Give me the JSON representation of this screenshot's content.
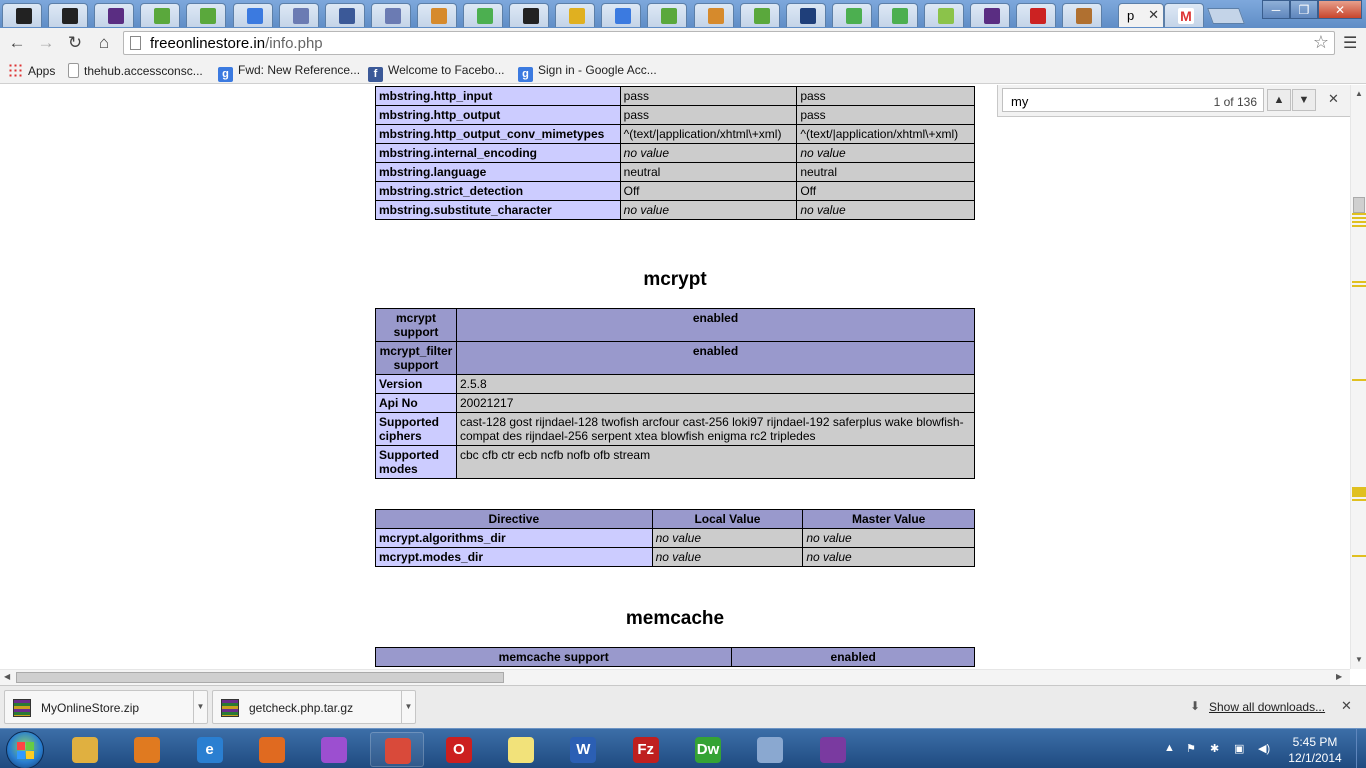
{
  "browser": {
    "active_tab_title": "p",
    "url_host": "freeonlinestore.in",
    "url_path": "/info.php",
    "tabs": [
      {
        "icon": "bookmark-black-icon",
        "color": "#222222"
      },
      {
        "icon": "bookmark-black-icon",
        "color": "#222222"
      },
      {
        "icon": "mail-purple-icon",
        "color": "#5a2d82"
      },
      {
        "icon": "evernote-green-icon",
        "color": "#5aa83c"
      },
      {
        "icon": "evernote-green-icon",
        "color": "#5aa83c"
      },
      {
        "icon": "google-blue-icon",
        "color": "#3b7ae0"
      },
      {
        "icon": "php-icon",
        "color": "#6b7bb3"
      },
      {
        "icon": "facebook-icon",
        "color": "#3b5998"
      },
      {
        "icon": "php-icon",
        "color": "#6b7bb3"
      },
      {
        "icon": "stack-icon",
        "color": "#d68a2c"
      },
      {
        "icon": "w3-green-icon",
        "color": "#4caf50"
      },
      {
        "icon": "bookmark-black-icon",
        "color": "#222222"
      },
      {
        "icon": "sun-icon",
        "color": "#e0b020"
      },
      {
        "icon": "google-blue-icon",
        "color": "#3b7ae0"
      },
      {
        "icon": "evernote-green-icon",
        "color": "#5aa83c"
      },
      {
        "icon": "stack-icon",
        "color": "#d68a2c"
      },
      {
        "icon": "evernote-green-icon",
        "color": "#5aa83c"
      },
      {
        "icon": "puzzle-icon",
        "color": "#1f3f7a"
      },
      {
        "icon": "w3-green-icon",
        "color": "#4caf50"
      },
      {
        "icon": "w3-green-icon",
        "color": "#4caf50"
      },
      {
        "icon": "php-green-icon",
        "color": "#8bc34a"
      },
      {
        "icon": "mail-purple-icon",
        "color": "#5a2d82"
      },
      {
        "icon": "youtube-icon",
        "color": "#cc2222"
      },
      {
        "icon": "picture-icon",
        "color": "#b07030"
      }
    ]
  },
  "bookmarks": [
    {
      "label": "Apps",
      "icon": "apps-grid-icon"
    },
    {
      "label": "thehub.accessconsc...",
      "icon": "page-icon",
      "color": "#ffffff"
    },
    {
      "label": "Fwd: New Reference...",
      "icon": "google-icon",
      "color": "#3b7ae0",
      "glyph": "g"
    },
    {
      "label": "Welcome to Facebo...",
      "icon": "facebook-icon",
      "color": "#3b5998",
      "glyph": "f"
    },
    {
      "label": "Sign in - Google Acc...",
      "icon": "google-icon",
      "color": "#3b7ae0",
      "glyph": "g"
    }
  ],
  "find": {
    "query": "my",
    "count": "1 of 136",
    "prev": "▲",
    "next": "▼",
    "close": "✕"
  },
  "mbstring_rows": [
    {
      "name": "mbstring.http_input",
      "local": "pass",
      "master": "pass",
      "nv": false
    },
    {
      "name": "mbstring.http_output",
      "local": "pass",
      "master": "pass",
      "nv": false
    },
    {
      "name": "mbstring.http_output_conv_mimetypes",
      "local": "^(text/|application/xhtml\\+xml)",
      "master": "^(text/|application/xhtml\\+xml)",
      "nv": false
    },
    {
      "name": "mbstring.internal_encoding",
      "local": "no value",
      "master": "no value",
      "nv": true
    },
    {
      "name": "mbstring.language",
      "local": "neutral",
      "master": "neutral",
      "nv": false
    },
    {
      "name": "mbstring.strict_detection",
      "local": "Off",
      "master": "Off",
      "nv": false
    },
    {
      "name": "mbstring.substitute_character",
      "local": "no value",
      "master": "no value",
      "nv": true
    }
  ],
  "mcrypt": {
    "heading": "mcrypt",
    "info_rows": [
      {
        "name": "mcrypt support",
        "value": "enabled",
        "header": true
      },
      {
        "name": "mcrypt_filter support",
        "value": "enabled",
        "header": true
      },
      {
        "name": "Version",
        "value": "2.5.8",
        "header": false
      },
      {
        "name": "Api No",
        "value": "20021217",
        "header": false
      },
      {
        "name": "Supported ciphers",
        "value": "cast-128 gost rijndael-128 twofish arcfour cast-256 loki97 rijndael-192 saferplus wake blowfish-compat des rijndael-256 serpent xtea blowfish enigma rc2 tripledes",
        "header": false
      },
      {
        "name": "Supported modes",
        "value": "cbc cfb ctr ecb ncfb nofb ofb stream",
        "header": false
      }
    ],
    "directive_headers": {
      "directive": "Directive",
      "local": "Local Value",
      "master": "Master Value"
    },
    "directive_rows": [
      {
        "name": "mcrypt.algorithms_dir",
        "local": "no value",
        "master": "no value"
      },
      {
        "name": "mcrypt.modes_dir",
        "local": "no value",
        "master": "no value"
      }
    ]
  },
  "memcache": {
    "heading": "memcache",
    "support_label": "memcache support",
    "support_value": "enabled"
  },
  "downloads": [
    {
      "name": "MyOnlineStore.zip"
    },
    {
      "name": "getcheck.php.tar.gz"
    }
  ],
  "show_all_downloads": "Show all downloads...",
  "taskbar": {
    "apps": [
      {
        "icon": "explorer-folder-icon",
        "color": "#e0b040"
      },
      {
        "icon": "media-player-icon",
        "color": "#e07a20"
      },
      {
        "icon": "internet-explorer-icon",
        "color": "#2a7fd1",
        "glyph": "e"
      },
      {
        "icon": "firefox-icon",
        "color": "#e06a20"
      },
      {
        "icon": "picasa-icon",
        "color": "#9c4fd0"
      },
      {
        "icon": "chrome-icon",
        "color": "#d94a3a"
      },
      {
        "icon": "opera-icon",
        "color": "#cc1f1f",
        "glyph": "O"
      },
      {
        "icon": "sticky-notes-icon",
        "color": "#f2e27a"
      },
      {
        "icon": "word-icon",
        "color": "#2b5fb4",
        "glyph": "W"
      },
      {
        "icon": "filezilla-icon",
        "color": "#bf1f1f",
        "glyph": "Fz"
      },
      {
        "icon": "dreamweaver-icon",
        "color": "#35a335",
        "glyph": "Dw"
      },
      {
        "icon": "paint-icon",
        "color": "#8aa8d0"
      },
      {
        "icon": "winrar-icon",
        "color": "#7a3aa0"
      }
    ],
    "time": "5:45 PM",
    "date": "12/1/2014"
  }
}
